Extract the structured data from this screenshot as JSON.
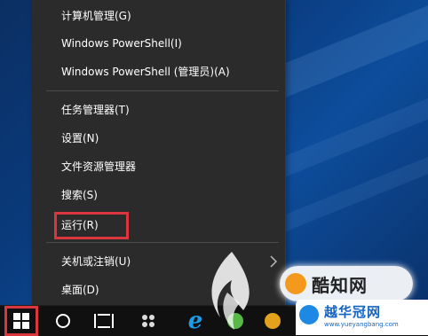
{
  "menu": {
    "items": [
      {
        "label": "计算机管理(G)"
      },
      {
        "label": "Windows PowerShell(I)"
      },
      {
        "label": "Windows PowerShell (管理员)(A)"
      },
      {
        "label": "任务管理器(T)"
      },
      {
        "label": "设置(N)"
      },
      {
        "label": "文件资源管理器"
      },
      {
        "label": "搜索(S)"
      },
      {
        "label": "运行(R)"
      },
      {
        "label": "关机或注销(U)"
      },
      {
        "label": "桌面(D)"
      }
    ],
    "highlighted_item": "运行(R)",
    "highlight_color": "#d9363e",
    "submenu_arrow": "chevron-right-icon"
  },
  "taskbar": {
    "icons": [
      "windows-start-icon",
      "cortana-circle-icon",
      "task-view-icon",
      "pinwheel-icon",
      "internet-explorer-icon",
      "green-app-icon",
      "orange-app-icon"
    ],
    "start_highlight_color": "#d9363e"
  },
  "watermarks": {
    "brand_text": "酷知网",
    "site_name": "越华冠网",
    "site_url": "www.yueyangbang.com"
  }
}
